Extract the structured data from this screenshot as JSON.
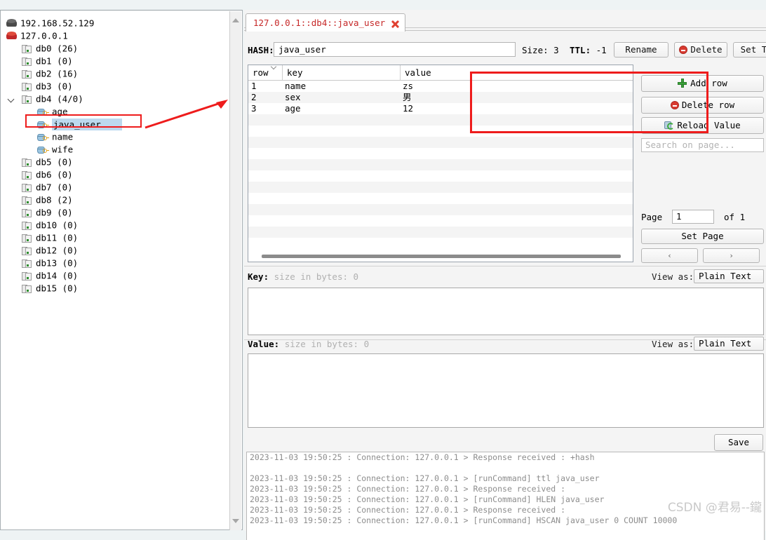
{
  "top_sliver_ghost": "",
  "tree": {
    "items": [
      {
        "label": "192.168.52.129",
        "icon": "server-dark-icon",
        "depth": 0,
        "type": "server",
        "selected": false,
        "twisty": ""
      },
      {
        "label": "127.0.0.1",
        "icon": "server-red-icon",
        "depth": 0,
        "type": "server",
        "selected": false,
        "twisty": ""
      },
      {
        "label": "db0  (26)",
        "icon": "database-icon",
        "depth": 1,
        "type": "db",
        "selected": false,
        "twisty": ""
      },
      {
        "label": "db1  (0)",
        "icon": "database-icon",
        "depth": 1,
        "type": "db",
        "selected": false,
        "twisty": ""
      },
      {
        "label": "db2  (16)",
        "icon": "database-icon",
        "depth": 1,
        "type": "db",
        "selected": false,
        "twisty": ""
      },
      {
        "label": "db3  (0)",
        "icon": "database-icon",
        "depth": 1,
        "type": "db",
        "selected": false,
        "twisty": ""
      },
      {
        "label": "db4   (4/0)",
        "icon": "database-icon",
        "depth": 1,
        "type": "db",
        "selected": false,
        "twisty": "expanded"
      },
      {
        "label": "age",
        "icon": "key-icon",
        "depth": 2,
        "type": "key",
        "selected": false,
        "twisty": ""
      },
      {
        "label": "java_user",
        "icon": "key-icon",
        "depth": 2,
        "type": "key",
        "selected": true,
        "twisty": ""
      },
      {
        "label": "name",
        "icon": "key-icon",
        "depth": 2,
        "type": "key",
        "selected": false,
        "twisty": ""
      },
      {
        "label": "wife",
        "icon": "key-icon",
        "depth": 2,
        "type": "key",
        "selected": false,
        "twisty": ""
      },
      {
        "label": "db5  (0)",
        "icon": "database-icon",
        "depth": 1,
        "type": "db",
        "selected": false,
        "twisty": ""
      },
      {
        "label": "db6  (0)",
        "icon": "database-icon",
        "depth": 1,
        "type": "db",
        "selected": false,
        "twisty": ""
      },
      {
        "label": "db7  (0)",
        "icon": "database-icon",
        "depth": 1,
        "type": "db",
        "selected": false,
        "twisty": ""
      },
      {
        "label": "db8  (2)",
        "icon": "database-icon",
        "depth": 1,
        "type": "db",
        "selected": false,
        "twisty": ""
      },
      {
        "label": "db9  (0)",
        "icon": "database-icon",
        "depth": 1,
        "type": "db",
        "selected": false,
        "twisty": ""
      },
      {
        "label": "db10  (0)",
        "icon": "database-icon",
        "depth": 1,
        "type": "db",
        "selected": false,
        "twisty": ""
      },
      {
        "label": "db11  (0)",
        "icon": "database-icon",
        "depth": 1,
        "type": "db",
        "selected": false,
        "twisty": ""
      },
      {
        "label": "db12  (0)",
        "icon": "database-icon",
        "depth": 1,
        "type": "db",
        "selected": false,
        "twisty": ""
      },
      {
        "label": "db13  (0)",
        "icon": "database-icon",
        "depth": 1,
        "type": "db",
        "selected": false,
        "twisty": ""
      },
      {
        "label": "db14  (0)",
        "icon": "database-icon",
        "depth": 1,
        "type": "db",
        "selected": false,
        "twisty": ""
      },
      {
        "label": "db15  (0)",
        "icon": "database-icon",
        "depth": 1,
        "type": "db",
        "selected": false,
        "twisty": ""
      }
    ]
  },
  "tab": {
    "label": "127.0.0.1::db4::java_user",
    "close_icon": "close-icon"
  },
  "hash": {
    "label": "HASH:",
    "value": "java_user",
    "size_label": "Size:",
    "size_value": "3",
    "ttl_label": "TTL:",
    "ttl_value": "-1",
    "rename_label": "Rename",
    "delete_label": "Delete",
    "set_ttl_label": "Set TTL"
  },
  "table": {
    "columns": [
      "row",
      "key",
      "value"
    ],
    "rows": [
      {
        "row": "1",
        "key": "name",
        "value": "zs"
      },
      {
        "row": "2",
        "key": "sex",
        "value": "男"
      },
      {
        "row": "3",
        "key": "age",
        "value": "12"
      }
    ],
    "empty_row_count": 11,
    "sort_column": "row"
  },
  "actions": {
    "add_row": "Add row",
    "delete_row": "Delete row",
    "reload_value": "Reload Value",
    "search_placeholder": "Search on page...",
    "search_value": "",
    "page_label": "Page",
    "page_value": "1",
    "page_of": "of 1",
    "set_page": "Set Page",
    "prev_label": "‹",
    "next_label": "›"
  },
  "key_section": {
    "label": "Key:",
    "size_text": "size in bytes: 0",
    "view_as_label": "View as:",
    "view_as_value": "Plain Text",
    "text": ""
  },
  "value_section": {
    "label": "Value:",
    "size_text": "size in bytes: 0",
    "view_as_label": "View as:",
    "view_as_value": "Plain Text",
    "text": ""
  },
  "save_label": "Save",
  "log": {
    "lines": [
      {
        "text": "2023-11-03 19:50:25 : Connection: 127.0.0.1 > Response received : +hash",
        "gap": false
      },
      {
        "text": "2023-11-03 19:50:25 : Connection: 127.0.0.1 > [runCommand] ttl java_user",
        "gap": true
      },
      {
        "text": "2023-11-03 19:50:25 : Connection: 127.0.0.1 > Response received :",
        "gap": false
      },
      {
        "text": "2023-11-03 19:50:25 : Connection: 127.0.0.1 > [runCommand] HLEN java_user",
        "gap": false
      },
      {
        "text": "2023-11-03 19:50:25 : Connection: 127.0.0.1 > Response received :",
        "gap": false
      },
      {
        "text": "2023-11-03 19:50:25 : Connection: 127.0.0.1 > [runCommand] HSCAN java_user 0 COUNT 10000",
        "gap": false
      }
    ]
  },
  "watermark": "CSDN @君易--鑨",
  "colors": {
    "accent_red": "#ee1c1c",
    "tab_text": "#c62828",
    "selection": "#bcd9ee",
    "panel_bg": "#f4f4f4"
  }
}
